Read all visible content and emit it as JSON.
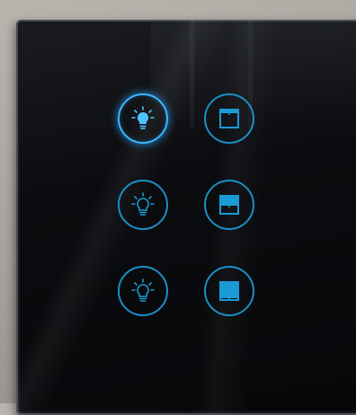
{
  "panel": {
    "label": "",
    "buttons": [
      {
        "id": "light-1",
        "icon": "lightbulb-icon",
        "active": true
      },
      {
        "id": "blind-1",
        "icon": "window-blind-icon",
        "active": false,
        "level": 0.15
      },
      {
        "id": "light-2",
        "icon": "lightbulb-icon",
        "active": false
      },
      {
        "id": "blind-2",
        "icon": "window-blind-icon",
        "active": false,
        "level": 0.5
      },
      {
        "id": "light-3",
        "icon": "lightbulb-icon",
        "active": false
      },
      {
        "id": "blind-3",
        "icon": "window-blind-icon",
        "active": false,
        "level": 0.9
      }
    ],
    "colors": {
      "accent": "#1a8fc6",
      "active_glow": "#3ab8ff",
      "glass": "#0b0c0f",
      "wall": "#b9b4ae"
    }
  }
}
